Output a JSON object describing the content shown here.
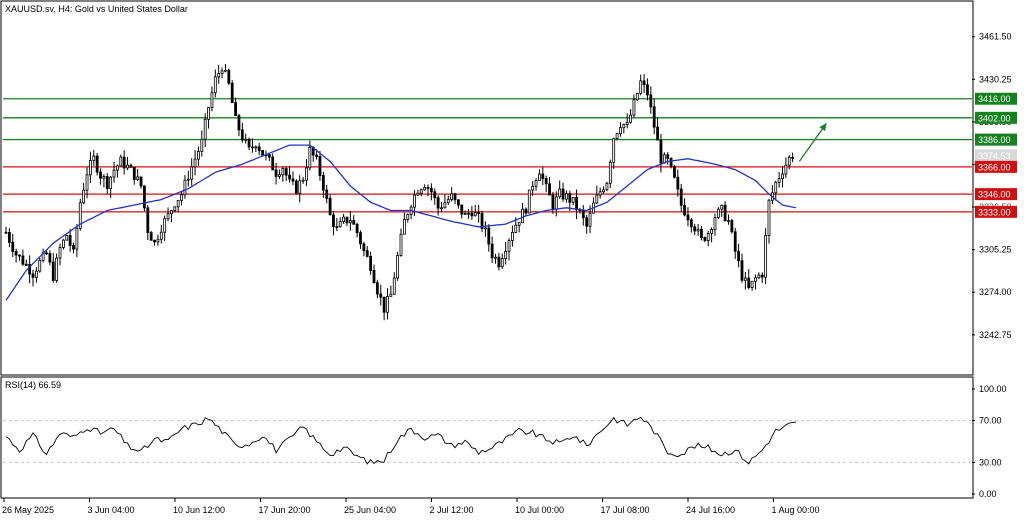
{
  "window": {
    "symbol_title": "XAUUSD.sv, H4:  Gold vs United States Dollar",
    "rsi_title": "RSI(14) 66.59"
  },
  "colors": {
    "candle": "#000000",
    "ma": "#1f33c8",
    "support": "#d01010",
    "resistance": "#14821e",
    "grid": "#c8c8c8",
    "current_price": "#d8d8d8"
  },
  "chart_data": [
    {
      "type": "candlestick",
      "title": "XAUUSD.sv, H4:  Gold vs United States Dollar",
      "y_ticks": [
        3242.75,
        3274.0,
        3305.25,
        3336.5,
        3367.75,
        3399.0,
        3430.25,
        3461.5
      ],
      "y_tick_labels": [
        "3242.75",
        "3274.00",
        "3305.25",
        "3336.50",
        "3367.75",
        "3399.00",
        "3430.25",
        "3461.50"
      ],
      "ylim": [
        3214,
        3487
      ],
      "x_labels": [
        "26 May 2025",
        "3 Jun 04:00",
        "10 Jun 12:00",
        "17 Jun 20:00",
        "25 Jun 04:00",
        "2 Jul 12:00",
        "10 Jul 00:00",
        "17 Jul 08:00",
        "24 Jul 16:00",
        "1 Aug 00:00"
      ],
      "price_anchors": [
        [
          0,
          3318
        ],
        [
          3,
          3302
        ],
        [
          6,
          3294
        ],
        [
          8,
          3288
        ],
        [
          10,
          3296
        ],
        [
          12,
          3302
        ],
        [
          14,
          3286
        ],
        [
          16,
          3306
        ],
        [
          18,
          3316
        ],
        [
          20,
          3302
        ],
        [
          22,
          3340
        ],
        [
          24,
          3362
        ],
        [
          26,
          3372
        ],
        [
          28,
          3360
        ],
        [
          30,
          3354
        ],
        [
          32,
          3364
        ],
        [
          34,
          3370
        ],
        [
          36,
          3366
        ],
        [
          38,
          3360
        ],
        [
          40,
          3352
        ],
        [
          42,
          3320
        ],
        [
          44,
          3310
        ],
        [
          46,
          3322
        ],
        [
          48,
          3330
        ],
        [
          50,
          3340
        ],
        [
          52,
          3346
        ],
        [
          54,
          3360
        ],
        [
          56,
          3372
        ],
        [
          58,
          3384
        ],
        [
          60,
          3410
        ],
        [
          62,
          3430
        ],
        [
          64,
          3440
        ],
        [
          66,
          3426
        ],
        [
          68,
          3400
        ],
        [
          70,
          3388
        ],
        [
          72,
          3378
        ],
        [
          74,
          3384
        ],
        [
          76,
          3376
        ],
        [
          78,
          3370
        ],
        [
          80,
          3362
        ],
        [
          82,
          3366
        ],
        [
          84,
          3354
        ],
        [
          86,
          3350
        ],
        [
          88,
          3358
        ],
        [
          90,
          3378
        ],
        [
          92,
          3370
        ],
        [
          94,
          3352
        ],
        [
          96,
          3330
        ],
        [
          98,
          3320
        ],
        [
          100,
          3326
        ],
        [
          102,
          3328
        ],
        [
          104,
          3318
        ],
        [
          106,
          3304
        ],
        [
          108,
          3294
        ],
        [
          110,
          3276
        ],
        [
          112,
          3262
        ],
        [
          114,
          3272
        ],
        [
          116,
          3300
        ],
        [
          118,
          3326
        ],
        [
          120,
          3340
        ],
        [
          122,
          3350
        ],
        [
          124,
          3354
        ],
        [
          126,
          3348
        ],
        [
          128,
          3336
        ],
        [
          130,
          3340
        ],
        [
          132,
          3344
        ],
        [
          134,
          3336
        ],
        [
          136,
          3330
        ],
        [
          138,
          3334
        ],
        [
          140,
          3328
        ],
        [
          142,
          3318
        ],
        [
          144,
          3302
        ],
        [
          146,
          3296
        ],
        [
          148,
          3308
        ],
        [
          150,
          3320
        ],
        [
          152,
          3328
        ],
        [
          154,
          3336
        ],
        [
          156,
          3354
        ],
        [
          158,
          3364
        ],
        [
          160,
          3350
        ],
        [
          162,
          3338
        ],
        [
          164,
          3346
        ],
        [
          166,
          3344
        ],
        [
          168,
          3340
        ],
        [
          170,
          3332
        ],
        [
          172,
          3322
        ],
        [
          174,
          3338
        ],
        [
          176,
          3348
        ],
        [
          178,
          3356
        ],
        [
          180,
          3388
        ],
        [
          182,
          3398
        ],
        [
          184,
          3396
        ],
        [
          186,
          3412
        ],
        [
          188,
          3428
        ],
        [
          190,
          3420
        ],
        [
          192,
          3396
        ],
        [
          194,
          3372
        ],
        [
          196,
          3370
        ],
        [
          198,
          3356
        ],
        [
          200,
          3338
        ],
        [
          202,
          3330
        ],
        [
          204,
          3322
        ],
        [
          206,
          3312
        ],
        [
          208,
          3318
        ],
        [
          210,
          3330
        ],
        [
          212,
          3334
        ],
        [
          214,
          3326
        ],
        [
          216,
          3304
        ],
        [
          218,
          3286
        ],
        [
          220,
          3276
        ],
        [
          222,
          3284
        ],
        [
          224,
          3288
        ],
        [
          226,
          3340
        ],
        [
          228,
          3354
        ],
        [
          230,
          3364
        ],
        [
          232,
          3372
        ],
        [
          233,
          3375
        ]
      ],
      "ma_anchors": [
        [
          0,
          3268
        ],
        [
          6,
          3290
        ],
        [
          14,
          3310
        ],
        [
          22,
          3324
        ],
        [
          30,
          3334
        ],
        [
          38,
          3338
        ],
        [
          46,
          3342
        ],
        [
          54,
          3350
        ],
        [
          62,
          3362
        ],
        [
          70,
          3368
        ],
        [
          78,
          3376
        ],
        [
          84,
          3382
        ],
        [
          90,
          3382
        ],
        [
          96,
          3370
        ],
        [
          102,
          3352
        ],
        [
          108,
          3340
        ],
        [
          114,
          3334
        ],
        [
          120,
          3334
        ],
        [
          126,
          3330
        ],
        [
          132,
          3326
        ],
        [
          140,
          3322
        ],
        [
          148,
          3324
        ],
        [
          154,
          3330
        ],
        [
          160,
          3334
        ],
        [
          166,
          3336
        ],
        [
          172,
          3334
        ],
        [
          178,
          3340
        ],
        [
          184,
          3352
        ],
        [
          190,
          3364
        ],
        [
          196,
          3370
        ],
        [
          202,
          3372
        ],
        [
          210,
          3368
        ],
        [
          216,
          3364
        ],
        [
          222,
          3356
        ],
        [
          226,
          3346
        ],
        [
          230,
          3338
        ],
        [
          234,
          3336
        ]
      ],
      "current_price": 3374.53,
      "current_price_label": "3374.53",
      "overlapped_tick_label": "3336.50",
      "support_levels": [
        3366.0,
        3346.0,
        3333.0
      ],
      "support_labels": [
        "3366.00",
        "3346.00",
        "3333.00"
      ],
      "resistance_levels": [
        3386.0,
        3402.0,
        3416.0
      ],
      "resistance_labels": [
        "3386.00",
        "3402.00",
        "3416.00"
      ],
      "arrow": {
        "from": [
          235,
          3370
        ],
        "to": [
          243,
          3398
        ]
      }
    },
    {
      "type": "line",
      "title": "RSI(14) 66.59",
      "ylim": [
        0,
        100
      ],
      "y_ticks": [
        0,
        30,
        70,
        100
      ],
      "y_tick_labels": [
        "0.00",
        "30.00",
        "70.00",
        "100.00"
      ],
      "dashed_levels": [
        30,
        70
      ],
      "last_value": 66.59,
      "rsi_anchors": [
        [
          0,
          55
        ],
        [
          4,
          42
        ],
        [
          8,
          56
        ],
        [
          12,
          38
        ],
        [
          16,
          58
        ],
        [
          20,
          54
        ],
        [
          24,
          64
        ],
        [
          28,
          58
        ],
        [
          32,
          62
        ],
        [
          36,
          46
        ],
        [
          40,
          40
        ],
        [
          44,
          52
        ],
        [
          48,
          50
        ],
        [
          52,
          62
        ],
        [
          56,
          66
        ],
        [
          60,
          72
        ],
        [
          64,
          60
        ],
        [
          68,
          46
        ],
        [
          72,
          48
        ],
        [
          76,
          56
        ],
        [
          80,
          42
        ],
        [
          84,
          52
        ],
        [
          88,
          64
        ],
        [
          92,
          50
        ],
        [
          96,
          38
        ],
        [
          100,
          44
        ],
        [
          104,
          36
        ],
        [
          108,
          30
        ],
        [
          112,
          32
        ],
        [
          116,
          52
        ],
        [
          120,
          62
        ],
        [
          124,
          54
        ],
        [
          128,
          56
        ],
        [
          132,
          46
        ],
        [
          136,
          50
        ],
        [
          140,
          40
        ],
        [
          144,
          44
        ],
        [
          148,
          52
        ],
        [
          152,
          60
        ],
        [
          156,
          58
        ],
        [
          160,
          52
        ],
        [
          164,
          48
        ],
        [
          168,
          56
        ],
        [
          172,
          46
        ],
        [
          176,
          60
        ],
        [
          180,
          72
        ],
        [
          184,
          66
        ],
        [
          188,
          74
        ],
        [
          192,
          60
        ],
        [
          196,
          40
        ],
        [
          200,
          38
        ],
        [
          204,
          46
        ],
        [
          208,
          44
        ],
        [
          212,
          38
        ],
        [
          216,
          42
        ],
        [
          220,
          30
        ],
        [
          224,
          42
        ],
        [
          228,
          60
        ],
        [
          232,
          66
        ],
        [
          234,
          67
        ]
      ]
    }
  ]
}
